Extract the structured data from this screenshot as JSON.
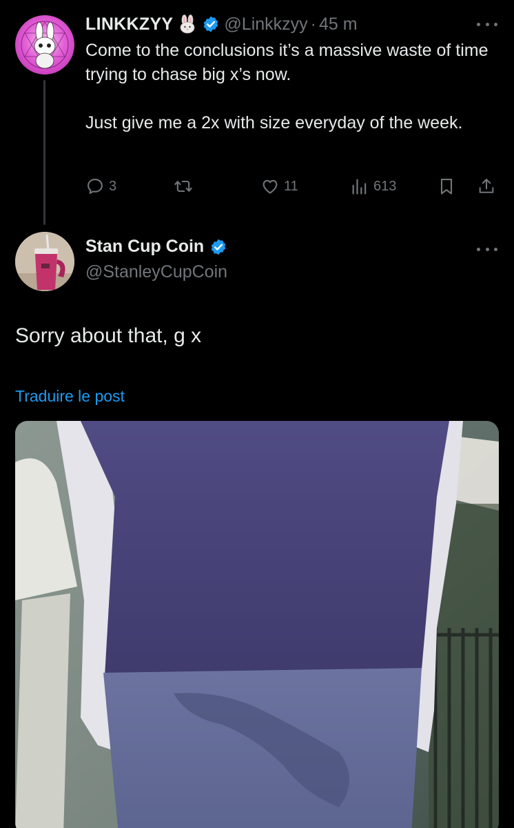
{
  "parent_tweet": {
    "display_name": "LINKKZYY",
    "name_emoji": "rabbit-face",
    "handle": "@Linkkzyy",
    "separator": "·",
    "time": "45 m",
    "text_lines": [
      "Come to the conclusions it’s a massive waste of time trying to chase big x’s now.",
      "Just give me a 2x with size everyday of the week."
    ],
    "actions": {
      "replies": "3",
      "reposts": "",
      "likes": "11",
      "views": "613"
    }
  },
  "reply_tweet": {
    "display_name": "Stan Cup Coin",
    "handle": "@StanleyCupCoin",
    "text": "Sorry about that, g x",
    "translate_label": "Traduire le post"
  },
  "colors": {
    "background": "#000000",
    "text_primary": "#e7e9ea",
    "text_secondary": "#71767b",
    "accent": "#1d9bf0",
    "verified": "#1d9bf0"
  }
}
